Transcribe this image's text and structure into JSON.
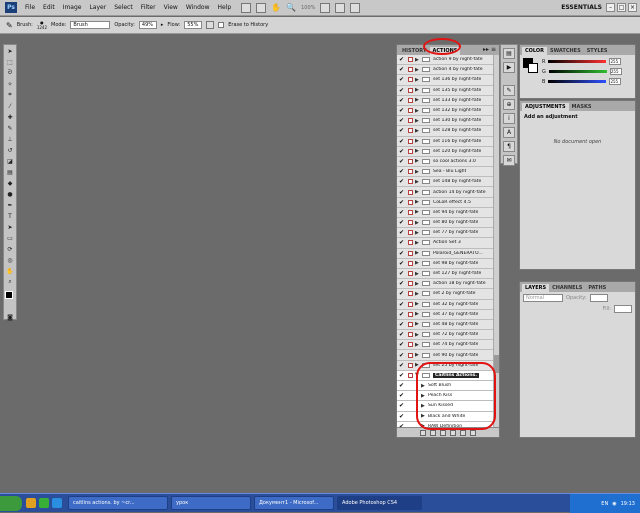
{
  "app": {
    "logo": "Ps",
    "workspace": "ESSENTIALS"
  },
  "menu": [
    "File",
    "Edit",
    "Image",
    "Layer",
    "Select",
    "Filter",
    "View",
    "Window",
    "Help"
  ],
  "zoom": "100%",
  "options": {
    "brush_label": "Brush:",
    "brush_size": "1242",
    "mode_label": "Mode:",
    "mode_value": "Brush",
    "opacity_label": "Opacity:",
    "opacity_value": "49%",
    "flow_label": "Flow:",
    "flow_value": "55%",
    "erase_label": "Erase to History"
  },
  "actions_panel": {
    "tabs": [
      "HISTORY",
      "ACTIONS"
    ],
    "active_tab": "ACTIONS",
    "rows": [
      "action 9 by night-fate",
      "action 4 by night-fate",
      "set 136 by night-fate",
      "set 135 by night-fate",
      "set 133 by night-fate",
      "set 132 by night-fate",
      "set 130 by night-fate",
      "set 128 by night-fate",
      "set 116 by night-fate",
      "set 120 by night-fate",
      "so cool actions 3.0",
      "Sea - Blu Light",
      "set 148 by night-fate",
      "action 14 by night-fate",
      "CoLoR effect 4.5",
      "set 94 by night-fate",
      "set 80 by night-fate",
      "set 77 by night-fate",
      "Action Set 3",
      "Polaroid_GENERATO...",
      "set 98 by night-fate",
      "set 127 by night-fate",
      "action 18 by night-fate",
      "set 2 by night-fate",
      "set 32 by night-fate",
      "set 37 by night-fate",
      "set 48 by night-fate",
      "set 72 by night-fate",
      "set 74 by night-fate",
      "set 90 by night-fate",
      "set 25 by night-fate"
    ],
    "expanded_set": "Caitlins Actions.",
    "sub_actions": [
      "Soft Blush",
      "Peach Kiss",
      "Sun Kissed",
      "Black and White",
      "RAW Definition"
    ]
  },
  "color_panel": {
    "tabs": [
      "COLOR",
      "SWATCHES",
      "STYLES"
    ],
    "channels": [
      {
        "label": "R",
        "value": "255",
        "color": "#ff3030"
      },
      {
        "label": "G",
        "value": "255",
        "color": "#30c030"
      },
      {
        "label": "B",
        "value": "255",
        "color": "#3050ff"
      }
    ]
  },
  "adjust_panel": {
    "tabs": [
      "ADJUSTMENTS",
      "MASKS"
    ],
    "heading": "Add an adjustment",
    "no_doc": "No document open"
  },
  "layers_panel": {
    "tabs": [
      "LAYERS",
      "CHANNELS",
      "PATHS"
    ],
    "mode": "Normal",
    "opacity_label": "Opacity:",
    "fill_label": "Fill:"
  },
  "taskbar": {
    "buttons": [
      "caitlins actions. by ~cr...",
      "урок",
      "Документ1 - Microsof...",
      "Adobe Photoshop CS4"
    ],
    "active": "Adobe Photoshop CS4",
    "lang": "EN",
    "clock": "19:13"
  }
}
